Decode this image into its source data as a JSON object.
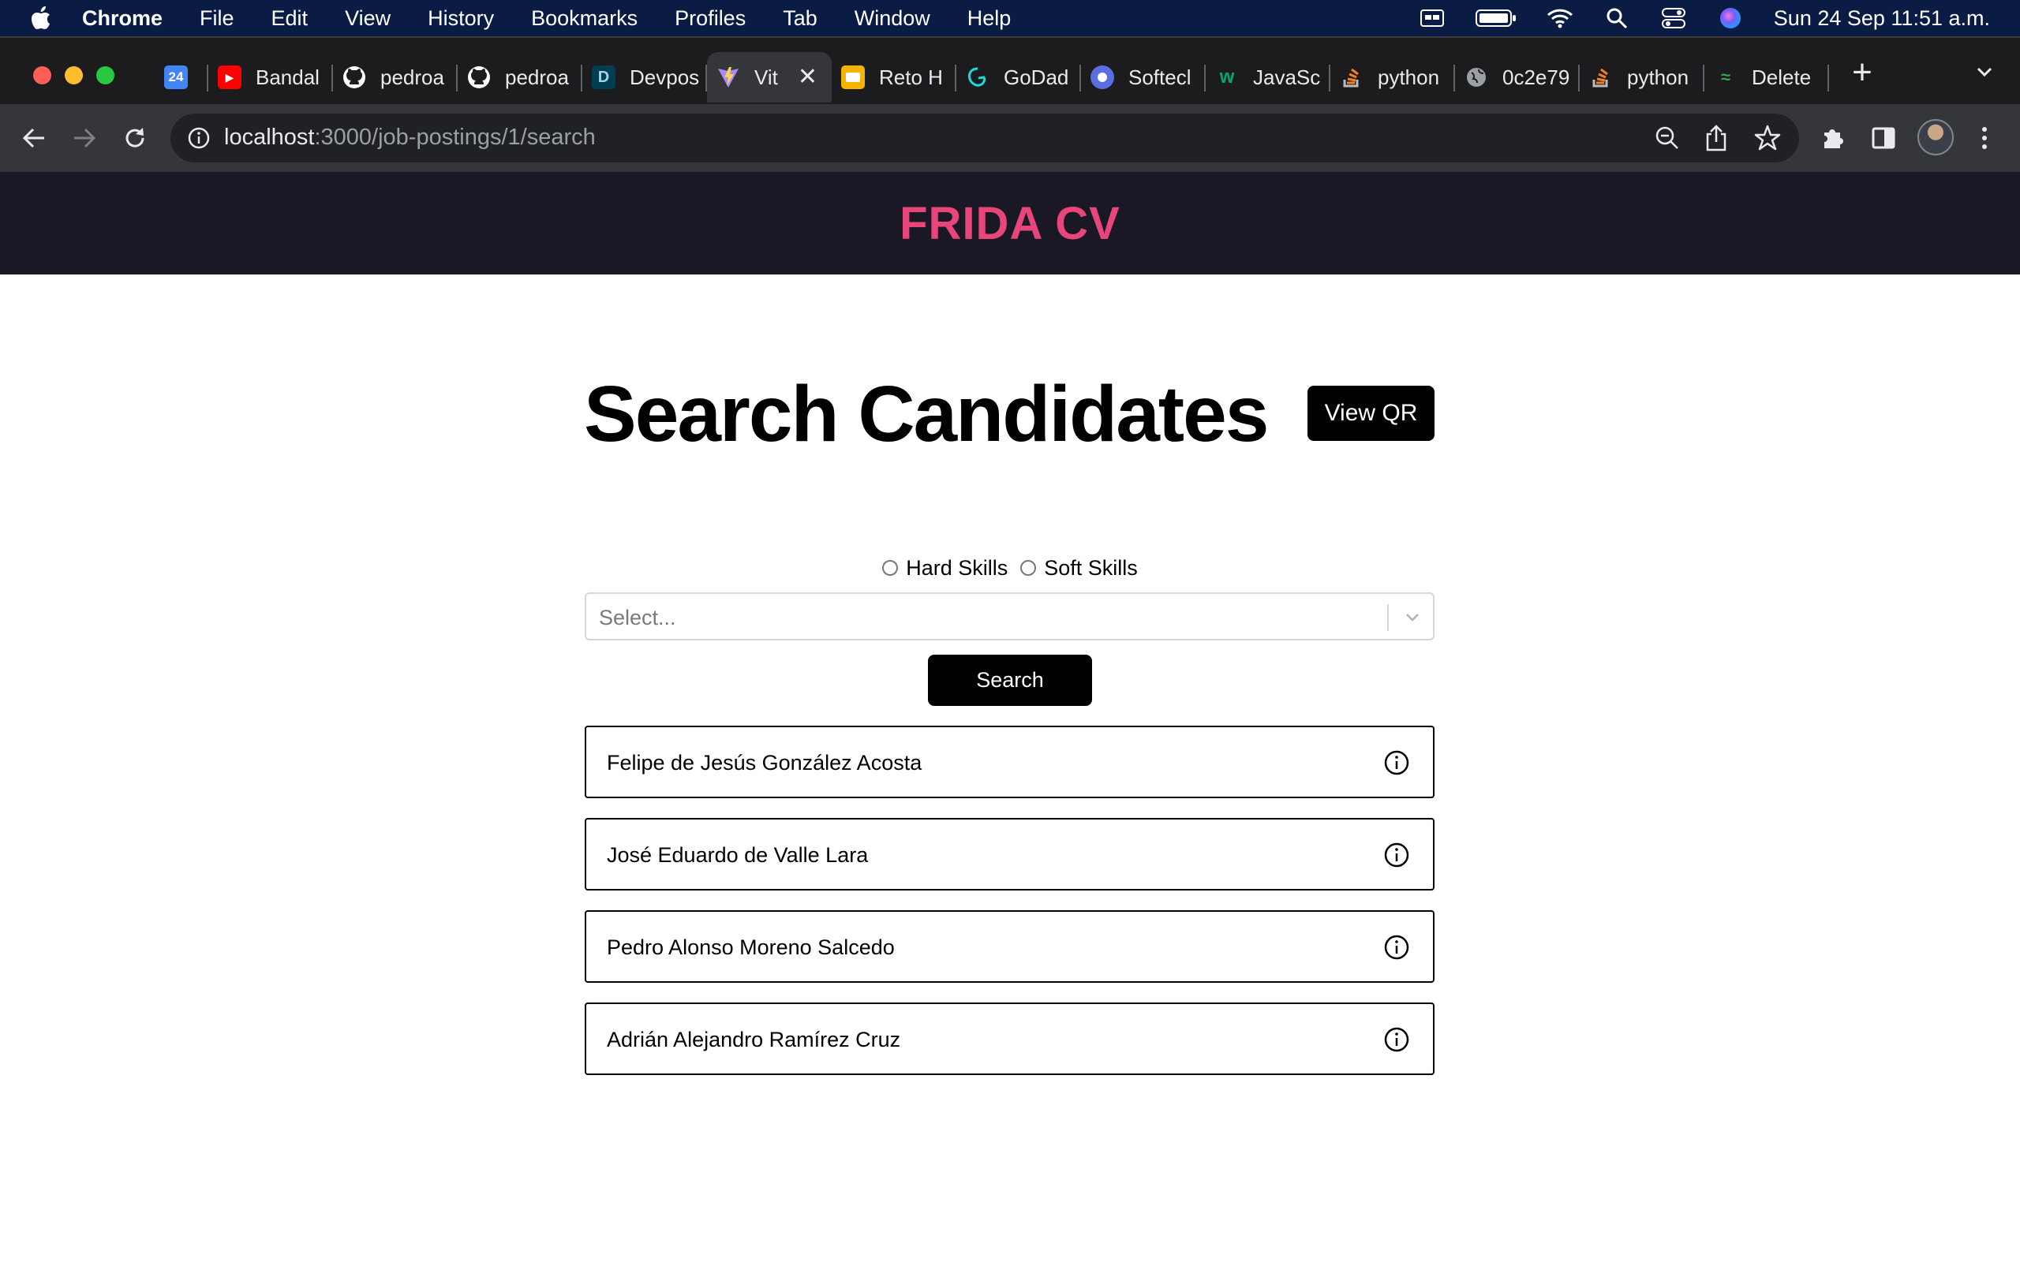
{
  "menubar": {
    "app_name": "Chrome",
    "items": [
      "File",
      "Edit",
      "View",
      "History",
      "Bookmarks",
      "Profiles",
      "Tab",
      "Window",
      "Help"
    ],
    "clock": "Sun 24 Sep  11:51 a.m."
  },
  "tabs": [
    {
      "title": "",
      "favicon": "calendar-icon",
      "color": "#4285f4"
    },
    {
      "title": "Bandal",
      "favicon": "youtube-icon",
      "color": "#ff0000"
    },
    {
      "title": "pedroa",
      "favicon": "github-icon",
      "color": "#1c1c1e"
    },
    {
      "title": "pedroa",
      "favicon": "github-icon",
      "color": "#1c1c1e"
    },
    {
      "title": "Devpos",
      "favicon": "devpost-icon",
      "color": "#003e54"
    },
    {
      "title": "Vit",
      "favicon": "vite-icon",
      "color": "#8a5cf6",
      "active": true
    },
    {
      "title": "Reto H",
      "favicon": "slides-icon",
      "color": "#f4b400"
    },
    {
      "title": "GoDad",
      "favicon": "godaddy-icon",
      "color": "#1bdbdb"
    },
    {
      "title": "Softecl",
      "favicon": "softech-icon",
      "color": "#5b6ee1"
    },
    {
      "title": "JavaSc",
      "favicon": "w3schools-icon",
      "color": "#04aa6d"
    },
    {
      "title": "python",
      "favicon": "stackoverflow-icon",
      "color": "#f48024"
    },
    {
      "title": "0c2e79",
      "favicon": "globe-icon",
      "color": "#9aa0a6"
    },
    {
      "title": "python",
      "favicon": "stackoverflow-icon",
      "color": "#f48024"
    },
    {
      "title": "Delete",
      "favicon": "strike-icon",
      "color": "#34a853"
    }
  ],
  "calendar_day": "24",
  "address_bar": {
    "host": "localhost",
    "path": ":3000/job-postings/1/search"
  },
  "page": {
    "brand": "FRIDA CV",
    "title": "Search Candidates",
    "view_qr_label": "View QR",
    "skill_options": [
      "Hard Skills",
      "Soft Skills"
    ],
    "select_placeholder": "Select...",
    "search_label": "Search",
    "candidates": [
      {
        "name": "Felipe de Jesús González Acosta"
      },
      {
        "name": "José Eduardo de Valle Lara"
      },
      {
        "name": "Pedro Alonso Moreno Salcedo"
      },
      {
        "name": "Adrián Alejandro Ramírez Cruz"
      }
    ]
  }
}
